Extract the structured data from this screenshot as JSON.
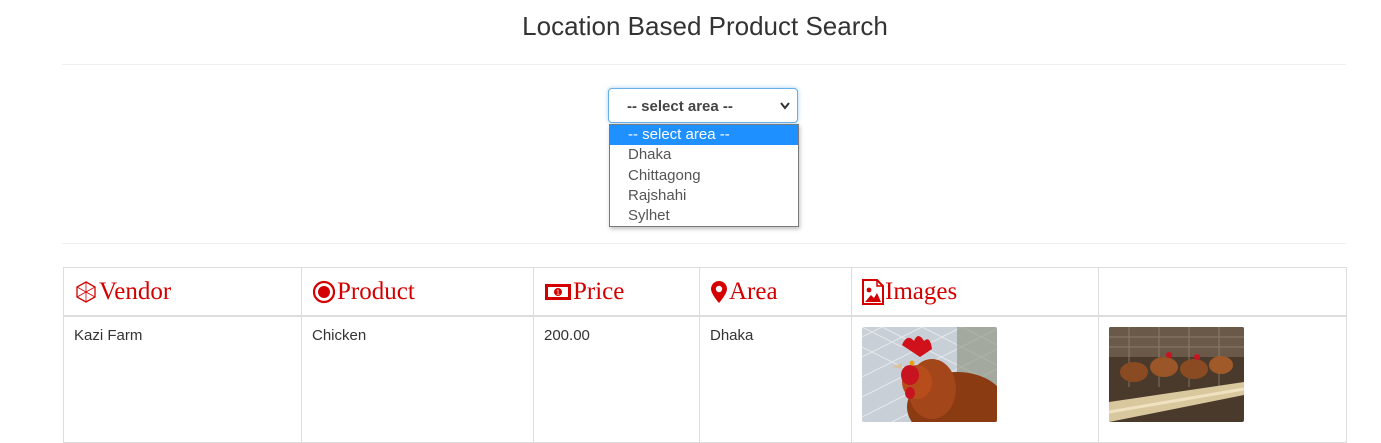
{
  "page": {
    "title": "Location Based Product Search"
  },
  "area_select": {
    "current_value": "-- select area --",
    "options": [
      "-- select area --",
      "Dhaka",
      "Chittagong",
      "Rajshahi",
      "Sylhet"
    ],
    "highlighted_index": 0
  },
  "table": {
    "headers": [
      {
        "label": "Vendor",
        "icon": "cube-icon"
      },
      {
        "label": "Product",
        "icon": "target-icon"
      },
      {
        "label": "Price",
        "icon": "money-icon"
      },
      {
        "label": "Area",
        "icon": "map-pin-icon"
      },
      {
        "label": "Images",
        "icon": "image-icon"
      },
      {
        "label": "",
        "icon": ""
      }
    ],
    "rows": [
      {
        "vendor": "Kazi Farm",
        "product": "Chicken",
        "price": "200.00",
        "area": "Dhaka",
        "image_1": "rooster-photo",
        "image_2": "poultry-farm-photo"
      }
    ]
  },
  "colors": {
    "header_text": "#d40000",
    "select_focus": "#66afe9",
    "option_highlight": "#1e90ff"
  }
}
